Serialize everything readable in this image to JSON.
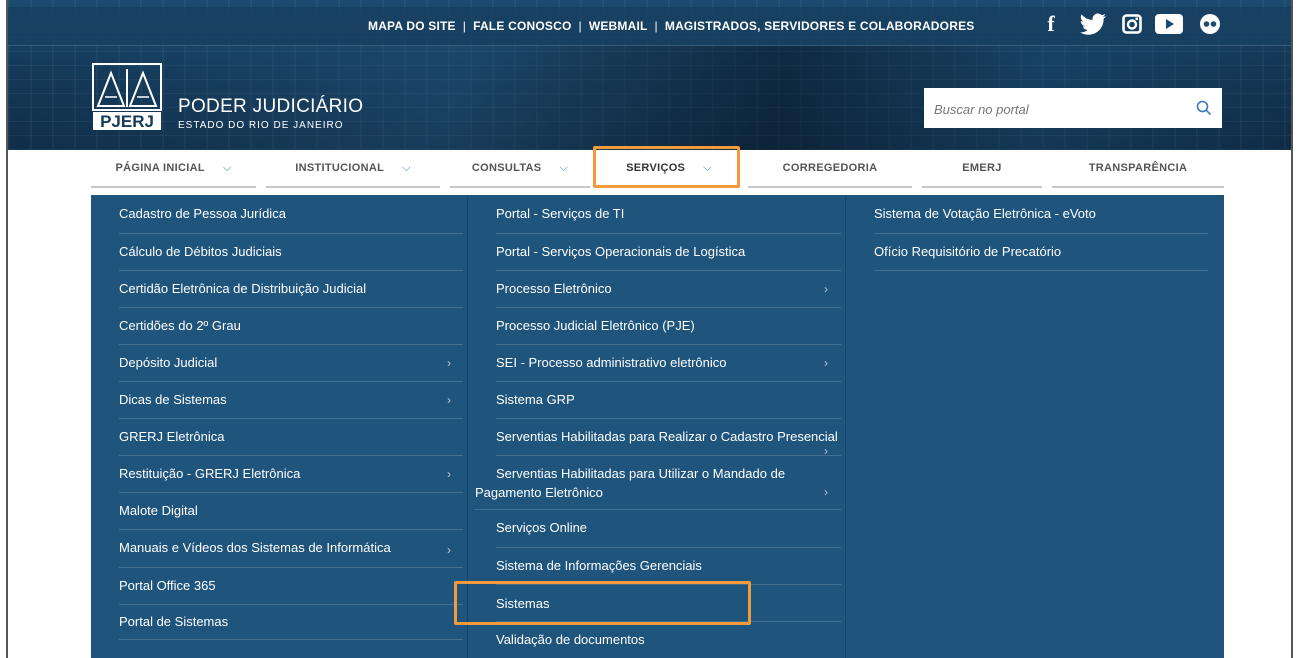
{
  "top_links": [
    "MAPA DO SITE",
    "FALE CONOSCO",
    "WEBMAIL",
    "MAGISTRADOS, SERVIDORES E COLABORADORES"
  ],
  "social_icons": [
    "facebook-icon",
    "twitter-icon",
    "instagram-icon",
    "youtube-icon",
    "flickr-icon"
  ],
  "brand": {
    "logo_text": "PJERJ",
    "title": "PODER JUDICIÁRIO",
    "subtitle": "ESTADO DO RIO DE JANEIRO"
  },
  "search": {
    "placeholder": "Buscar no portal",
    "value": ""
  },
  "nav": [
    {
      "label": "PÁGINA INICIAL",
      "chevron": "⌵"
    },
    {
      "label": "INSTITUCIONAL",
      "chevron": "⌵"
    },
    {
      "label": "CONSULTAS",
      "chevron": "⌵"
    },
    {
      "label": "SERVIÇOS",
      "chevron": "⌵",
      "active": true
    },
    {
      "label": "CORREGEDORIA"
    },
    {
      "label": "EMERJ"
    },
    {
      "label": "TRANSPARÊNCIA"
    }
  ],
  "menu": {
    "col1": [
      {
        "label": "Cadastro de Pessoa Jurídica"
      },
      {
        "label": "Cálculo de Débitos Judiciais"
      },
      {
        "label": "Certidão Eletrônica de Distribuição Judicial"
      },
      {
        "label": "Certidões do 2º Grau"
      },
      {
        "label": "Depósito Judicial",
        "arrow": "›"
      },
      {
        "label": "Dicas de Sistemas",
        "arrow": "›"
      },
      {
        "label": "GRERJ Eletrônica"
      },
      {
        "label": "Restituição - GRERJ Eletrônica",
        "arrow": "›"
      },
      {
        "label": "Malote Digital"
      },
      {
        "label": "Manuais e Vídeos dos Sistemas de Informática",
        "arrow": "›"
      },
      {
        "label": "Portal Office 365"
      },
      {
        "label": "Portal de Sistemas"
      }
    ],
    "col2": [
      {
        "label": "Portal - Serviços de TI"
      },
      {
        "label": "Portal - Serviços Operacionais de Logística"
      },
      {
        "label": "Processo Eletrônico",
        "arrow": "›"
      },
      {
        "label": "Processo Judicial Eletrônico (PJE)"
      },
      {
        "label": "SEI - Processo administrativo eletrônico",
        "arrow": "›"
      },
      {
        "label": "Sistema GRP"
      },
      {
        "label": "Serventias Habilitadas para Realizar o Cadastro Presencial",
        "arrow": "›"
      },
      {
        "label": "Serventias Habilitadas para Utilizar o Mandado de",
        "label2": "Pagamento Eletrônico",
        "arrow": "›"
      },
      {
        "label": "Serviços Online"
      },
      {
        "label": "Sistema de Informações Gerenciais"
      },
      {
        "label": "Sistemas"
      },
      {
        "label": "Validação de documentos"
      }
    ],
    "col3": [
      {
        "label": "Sistema de Votação Eletrônica - eVoto"
      },
      {
        "label": "Ofício Requisitório de Precatório"
      }
    ]
  },
  "colors": {
    "header_bg": "#1b4b70",
    "menu_bg": "#1f557d",
    "highlight": "#f39a3a",
    "nav_chevron": "#3b79b8"
  }
}
